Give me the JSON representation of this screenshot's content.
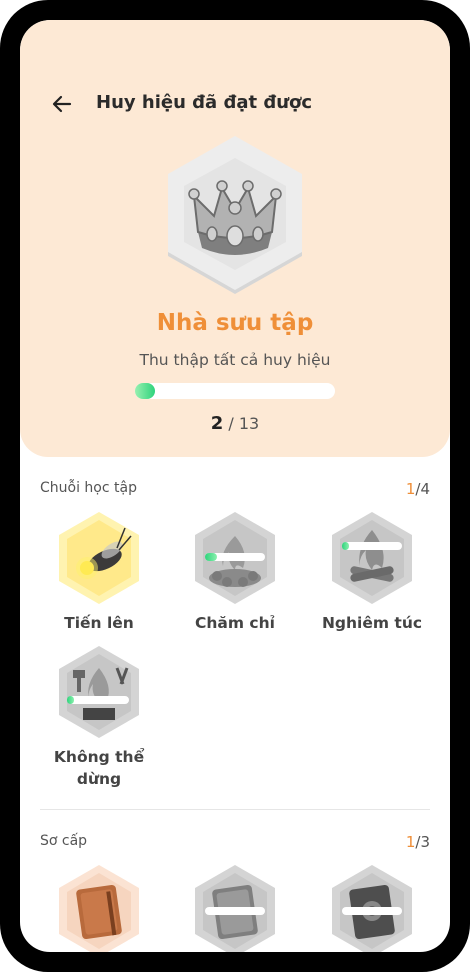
{
  "header": {
    "title": "Huy hiệu đã đạt được"
  },
  "badge": {
    "icon": "crown-icon",
    "name": "Nhà sưu tập",
    "description": "Thu thập tất cả huy hiệu",
    "progress_fraction": 0.07,
    "progress_current": "2",
    "progress_separator": " / ",
    "progress_total": "13"
  },
  "colors": {
    "accent": "#ef8f38",
    "hero_bg": "#fde9d5",
    "progress": "#2ed37c"
  },
  "sections": [
    {
      "title": "Chuỗi học tập",
      "earned": "1",
      "total_text": "/4",
      "badges": [
        {
          "label": "Tiến lên",
          "icon": "firefly-icon",
          "earned": true,
          "progress": null
        },
        {
          "label": "Chăm chỉ",
          "icon": "campfire-icon",
          "earned": false,
          "progress": 0.2
        },
        {
          "label": "Nghiêm túc",
          "icon": "bonfire-icon",
          "earned": false,
          "progress": 0.08
        },
        {
          "label": "Không thể dừng",
          "icon": "forge-icon",
          "earned": false,
          "progress": 0.03
        }
      ]
    },
    {
      "title": "Sơ cấp",
      "earned": "1",
      "total_text": "/3",
      "badges": [
        {
          "icon": "notebook-icon",
          "earned": true,
          "progress": null
        },
        {
          "icon": "book-icon",
          "earned": false,
          "progress": 0.0
        },
        {
          "icon": "ornate-book-icon",
          "earned": false,
          "progress": 0.0
        }
      ]
    }
  ]
}
